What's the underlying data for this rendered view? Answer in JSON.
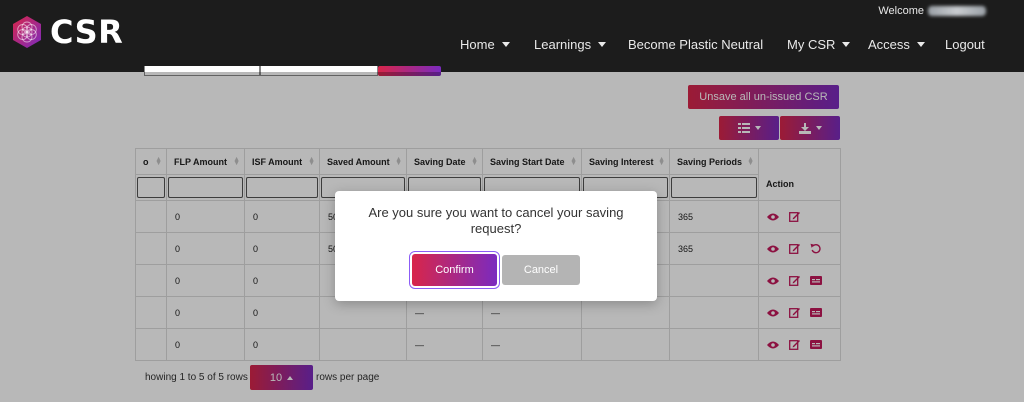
{
  "brand": {
    "name": "CSR",
    "accent_gradient": [
      "#d8264a",
      "#7b2bbf"
    ],
    "navbar_bg": "#1c1c1c"
  },
  "header": {
    "welcome_label": "Welcome"
  },
  "nav": {
    "home": "Home",
    "learnings": "Learnings",
    "plastic": "Become Plastic Neutral",
    "mycsr": "My CSR",
    "access": "Access",
    "logout": "Logout"
  },
  "toolbar": {
    "unsave_label": "Unsave all un-issued CSR",
    "columns_icon": "list-icon",
    "export_icon": "download-icon"
  },
  "table": {
    "headers": {
      "partial": "o",
      "flp": "FLP Amount",
      "isf": "ISF Amount",
      "saved": "Saved Amount",
      "saving_date": "Saving Date",
      "saving_start": "Saving Start Date",
      "saving_interest": "Saving Interest",
      "saving_periods": "Saving Periods",
      "action": "Action"
    },
    "rows": [
      {
        "flp": "0",
        "isf": "0",
        "saved": "50",
        "saving_date": "",
        "saving_start": "",
        "interest": "",
        "periods": "365"
      },
      {
        "flp": "0",
        "isf": "0",
        "saved": "50",
        "saving_date": "",
        "saving_start": "",
        "interest": "",
        "periods": "365"
      },
      {
        "flp": "0",
        "isf": "0",
        "saved": "",
        "saving_date": "",
        "saving_start": "",
        "interest": "",
        "periods": ""
      },
      {
        "flp": "0",
        "isf": "0",
        "saved": "",
        "saving_date": "—",
        "saving_start": "—",
        "interest": "",
        "periods": ""
      },
      {
        "flp": "0",
        "isf": "0",
        "saved": "",
        "saving_date": "—",
        "saving_start": "—",
        "interest": "",
        "periods": ""
      }
    ]
  },
  "pagination": {
    "showing": "howing 1 to 5 of 5 rows",
    "page_size": "10",
    "rows_per_page": "rows per page"
  },
  "modal": {
    "message": "Are you sure you want to cancel your saving request?",
    "confirm": "Confirm",
    "cancel": "Cancel"
  }
}
